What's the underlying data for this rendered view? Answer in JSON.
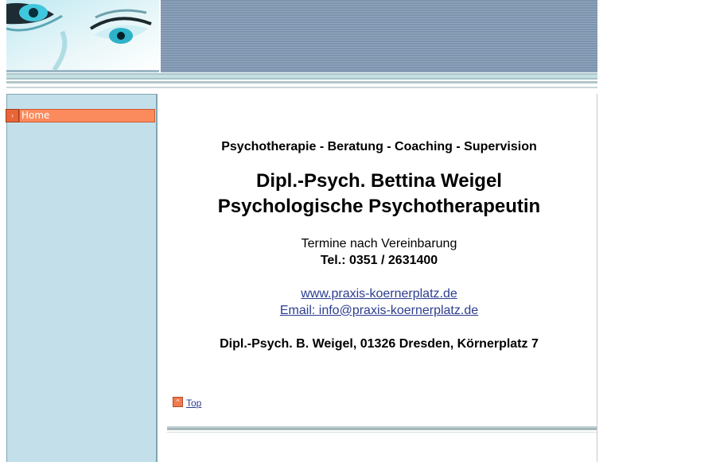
{
  "sidebar": {
    "items": [
      {
        "label": "Home",
        "icon": "arrow-right-icon"
      }
    ]
  },
  "main": {
    "subtitle": "Psychotherapie - Beratung - Coaching - Supervision",
    "title_line1": "Dipl.-Psych. Bettina Weigel",
    "title_line2": "Psychologische Psychotherapeutin",
    "appointments": "Termine nach Vereinbarung",
    "phone": "Tel.: 0351 / 2631400",
    "website": "www.praxis-koernerplatz.de",
    "email": "Email: info@praxis-koernerplatz.de",
    "address": "Dipl.-Psych. B. Weigel, 01326 Dresden, Körnerplatz 7"
  },
  "footer": {
    "top_label": "Top",
    "top_icon": "arrow-up-icon"
  },
  "colors": {
    "sidebar_bg": "#c3e0ea",
    "nav_active": "#fb8a5d",
    "header_stripes": "#7d93ad",
    "link": "#2b3d8f"
  }
}
